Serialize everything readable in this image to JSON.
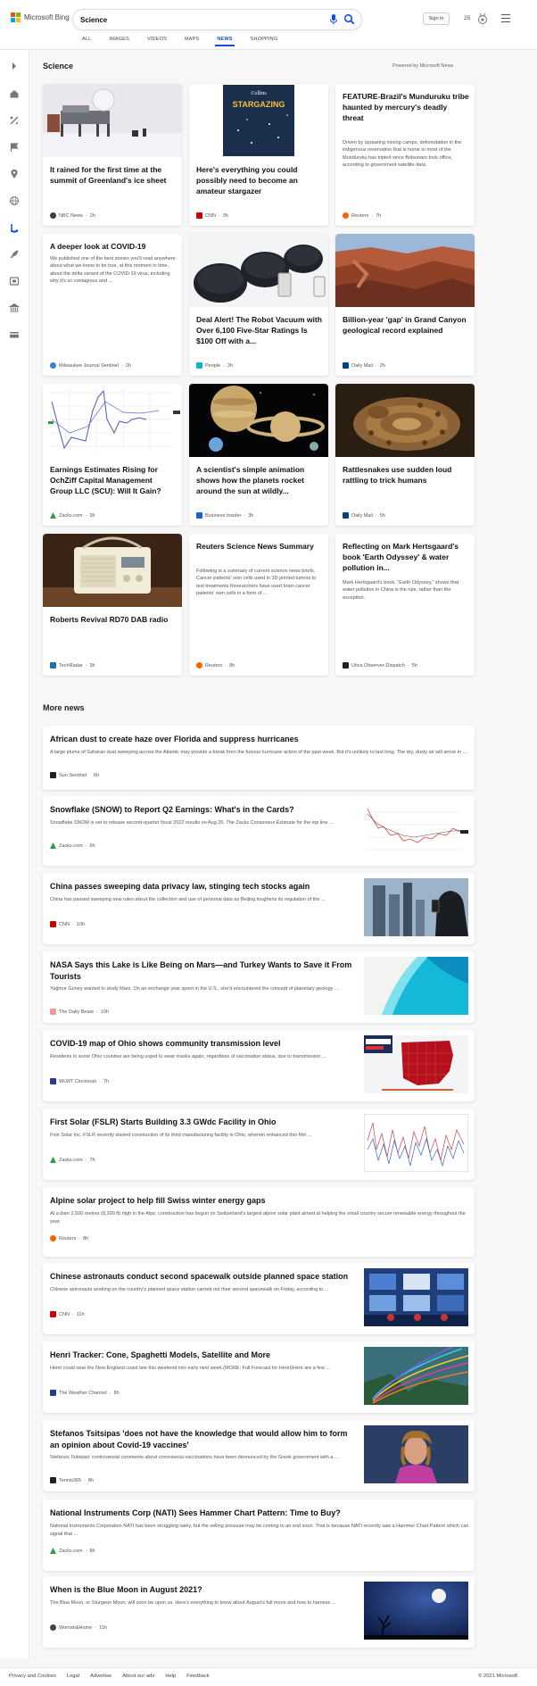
{
  "header": {
    "logo_text": "Microsoft Bing",
    "search_value": "Science",
    "tabs": [
      {
        "label": "ALL"
      },
      {
        "label": "IMAGES"
      },
      {
        "label": "VIDEOS"
      },
      {
        "label": "MAPS"
      },
      {
        "label": "NEWS"
      },
      {
        "label": "SHOPPING"
      }
    ],
    "active_tab": "NEWS",
    "signin_label": "Sign in",
    "reward_points": "25"
  },
  "rail": {
    "icons": [
      "chevron-right-icon",
      "home-icon",
      "tools-icon",
      "flag-icon",
      "location-icon",
      "globe-icon",
      "science-icon",
      "rocket-icon",
      "entertainment-icon",
      "government-icon",
      "money-icon"
    ]
  },
  "science": {
    "title": "Science",
    "powered_by": "Powered by Microsoft News",
    "cards": [
      {
        "title": "It rained for the first time at the summit of Greenland's ice sheet",
        "snippet": "",
        "source": "NBC News",
        "time": "2h",
        "has_image": true,
        "image": "greenland-station"
      },
      {
        "title": "Here's everything you could possibly need to become an amateur stargazer",
        "snippet": "",
        "source": "CNN",
        "time": "3h",
        "has_image": true,
        "image": "stargazing-book"
      },
      {
        "title": "FEATURE-Brazil's Munduruku tribe haunted by mercury's deadly threat",
        "snippet": "Driven by sprawling mining camps, deforestation in the indigenous reservation that is home to most of the Munduruku has tripled since Bolsonaro took office, according to government satellite data.",
        "source": "Reuters",
        "time": "7h",
        "has_image": false
      },
      {
        "title": "A deeper look at COVID-19",
        "snippet": "We published one of the best stories you'll read anywhere about what we know to be true, at this moment in time, about the delta variant of the COVID-19 virus, including why it's so contagious and ...",
        "source": "Milwaukee Journal Sentinel",
        "time": "2h",
        "has_image": false
      },
      {
        "title": "Deal Alert! The Robot Vacuum with Over 6,100 Five-Star Ratings Is $100 Off with a...",
        "snippet": "",
        "source": "People",
        "time": "2h",
        "has_image": true,
        "image": "robot-vacuum"
      },
      {
        "title": "Billion-year 'gap' in Grand Canyon geological record explained",
        "snippet": "",
        "source": "Daily Mail",
        "time": "2h",
        "has_image": true,
        "image": "grand-canyon"
      },
      {
        "title": "Earnings Estimates Rising for OchZiff Capital Management Group LLC (SCU): Will It Gain?",
        "snippet": "",
        "source": "Zacks.com",
        "time": "3h",
        "has_image": true,
        "image": "stock-chart"
      },
      {
        "title": "A scientist's simple animation shows how the planets rocket around the sun at wildly...",
        "snippet": "",
        "source": "Business Insider",
        "time": "3h",
        "has_image": true,
        "image": "planets"
      },
      {
        "title": "Rattlesnakes use sudden loud rattling to trick humans",
        "snippet": "",
        "source": "Daily Mail",
        "time": "5h",
        "has_image": true,
        "image": "rattlesnake"
      },
      {
        "title": "Roberts Revival RD70 DAB radio",
        "snippet": "",
        "source": "TechRadar",
        "time": "3h",
        "has_image": true,
        "image": "radio"
      },
      {
        "title": "Reuters Science News Summary",
        "snippet": "Following is a summary of current science news briefs. Cancer patients' own cells used in 3D printed tumors to test treatments Researchers have used brain cancer patients' own cells in a form of ...",
        "source": "Reuters",
        "time": "8h",
        "has_image": false
      },
      {
        "title": "Reflecting on Mark Hertsgaard's book 'Earth Odyssey' & water pollution in...",
        "snippet": "Mark Hertsgaard's book, \"Earth Odyssey,\" shows that water pollution in China is the rule, rather than the exception.",
        "source": "Utica Observer-Dispatch",
        "time": "5h",
        "has_image": false
      }
    ]
  },
  "more_news": {
    "title": "More news",
    "items": [
      {
        "title": "African dust to create haze over Florida and suppress hurricanes",
        "snippet": "A large plume of Saharan dust sweeping across the Atlantic may provide a break from the furious hurricane action of the past week. But it's unlikely to last long. The dry, dusty air will arrive in ...",
        "source": "Sun Sentinel",
        "time": "6h",
        "thumb": ""
      },
      {
        "title": "Snowflake (SNOW) to Report Q2 Earnings: What's in the Cards?",
        "snippet": "Snowflake SNOW is set to release second-quarter fiscal 2022 results on Aug 25. The Zacks Consensus Estimate for the top line ...",
        "source": "Zacks.com",
        "time": "6h",
        "thumb": "stock-chart"
      },
      {
        "title": "China passes sweeping data privacy law, stinging tech stocks again",
        "snippet": "China has passed sweeping new rules about the collection and use of personal data as Beijing toughens its regulation of the ...",
        "source": "CNN",
        "time": "10h",
        "thumb": "city-phone"
      },
      {
        "title": "NASA Says this Lake is Like Being on Mars—and Turkey Wants to Save it From Tourists",
        "snippet": "Yağmur Güney wanted to study Mars. On an exchange year spent in the U.S., she'd encountered the concept of planetary geology ...",
        "source": "The Daily Beast",
        "time": "10h",
        "thumb": "lake"
      },
      {
        "title": "COVID-19 map of Ohio shows community transmission level",
        "snippet": "Residents in some Ohio counties are being urged to wear masks again, regardless of vaccination status, due to transmission ...",
        "source": "WLWT Cincinnati",
        "time": "7h",
        "thumb": "ohio-map"
      },
      {
        "title": "First Solar (FSLR) Starts Building 3.3 GWdc Facility in Ohio",
        "snippet": "First Solar Inc. FSLR recently started construction of its third manufacturing facility in Ohio, wherein enhanced thin film ...",
        "source": "Zacks.com",
        "time": "7h",
        "thumb": "solar-chart"
      },
      {
        "title": "Alpine solar project to help fill Swiss winter energy gaps",
        "snippet": "At a dam 2,500 metres (8,200 ft) high in the Alps, construction has begun on Switzerland's largest alpine solar plant aimed at helping the small country secure renewable energy throughout the year.",
        "source": "Reuters",
        "time": "8h",
        "thumb": ""
      },
      {
        "title": "Chinese astronauts conduct second spacewalk outside planned space station",
        "snippet": "Chinese astronauts working on the country's planned space station carried out their second spacewalk on Friday, according to ...",
        "source": "CNN",
        "time": "11h",
        "thumb": "control-room"
      },
      {
        "title": "Henri Tracker: Cone, Spaghetti Models, Satellite and More",
        "snippet": "Henri could near the New England coast late this weekend into early next week.(MORE: Full Forecast for Henri)Here are a few ...",
        "source": "The Weather Channel",
        "time": "8h",
        "thumb": "spaghetti"
      },
      {
        "title": "Stefanos Tsitsipas 'does not have the knowledge that would allow him to form an opinion about Covid-19 vaccines'",
        "snippet": "Stefanos Tsitsipas' controversial comments about coronavirus vaccinations have been denounced by the Greek government with a ...",
        "source": "Tennis365",
        "time": "8h",
        "thumb": "tennis-player"
      },
      {
        "title": "National Instruments Corp (NATI) Sees Hammer Chart Pattern: Time to Buy?",
        "snippet": "National Instruments Corporation NATI has been struggling lately, but the selling pressure may be coming to an end soon. That is because NATI recently saw a Hammer Chart Pattern which can signal that ...",
        "source": "Zacks.com",
        "time": "8h",
        "thumb": ""
      },
      {
        "title": "When is the Blue Moon in August 2021?",
        "snippet": "The Blue Moon, or Sturgeon Moon, will soon be upon us. Here's everything to know about August's full moon and how to harness ...",
        "source": "Woman&Home",
        "time": "11h",
        "thumb": "moon"
      }
    ]
  },
  "footer": {
    "links": [
      "Privacy and Cookies",
      "Legal",
      "Advertise",
      "About our ads",
      "Help",
      "Feedback"
    ],
    "copyright": "© 2021 Microsoft"
  },
  "colors": {
    "accent": "#174ae4",
    "bing_red": "#f25022",
    "bing_green": "#7fba00",
    "bing_blue": "#00a4ef",
    "bing_yellow": "#ffb900"
  }
}
